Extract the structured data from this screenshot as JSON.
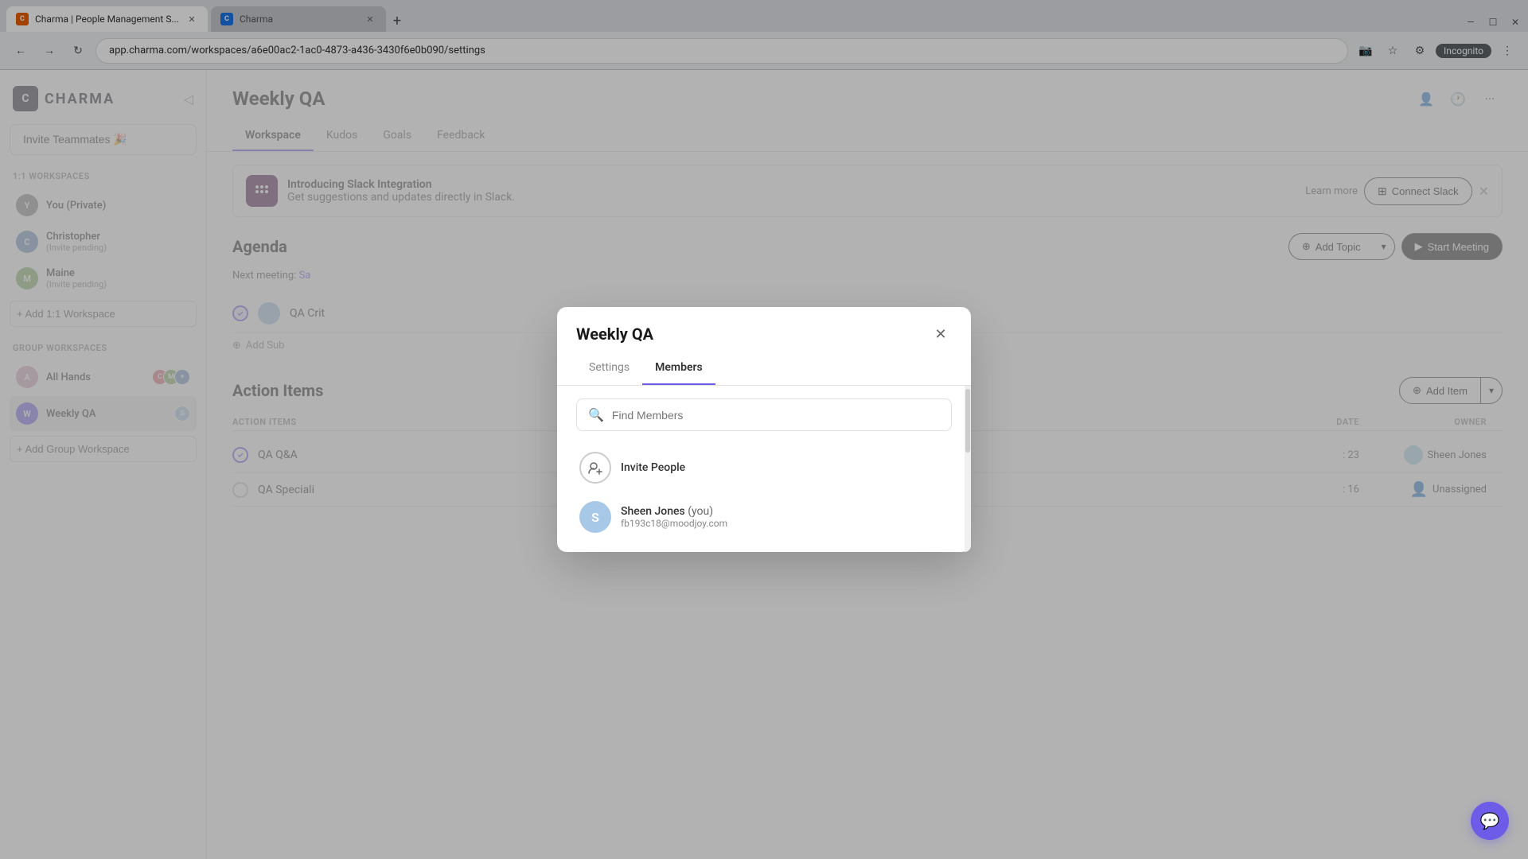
{
  "browser": {
    "tabs": [
      {
        "id": "tab1",
        "label": "Charma | People Management S...",
        "favicon": "C",
        "active": true
      },
      {
        "id": "tab2",
        "label": "Charma",
        "favicon": "C",
        "active": false
      }
    ],
    "address": "app.charma.com/workspaces/a6e00ac2-1ac0-4873-a436-3430f6e0b090/settings",
    "incognito_label": "Incognito"
  },
  "sidebar": {
    "logo_text": "CHARMA",
    "invite_btn": "Invite Teammates 🎉",
    "section_11": "1:1 Workspaces",
    "you_private": "You (Private)",
    "christopher": {
      "name": "Christopher",
      "sub": "(Invite pending)"
    },
    "maine": {
      "name": "Maine",
      "sub": "(Invite pending)"
    },
    "add_11_btn": "+ Add 1:1 Workspace",
    "section_group": "Group Workspaces",
    "all_hands": "All Hands",
    "weekly_qa": "Weekly QA",
    "add_group_btn": "+ Add Group Workspace"
  },
  "main": {
    "page_title": "Weekly QA",
    "tabs": [
      "Workspace",
      "Kudos",
      "Goals",
      "Feedback"
    ],
    "active_tab": "Workspace",
    "slack_banner": {
      "title": "Introducing Slack Integration",
      "description": "Get suggestions and updates directly in Slack.",
      "learn_more": "Learn more",
      "connect_btn": "Connect Slack"
    },
    "agenda": {
      "title": "Agenda",
      "next_meeting": "Next meeting: Sa",
      "add_topic_btn": "Add Topic",
      "start_meeting_btn": "Start Meeting",
      "item": "QA Crit",
      "add_sub": "Add Sub"
    },
    "action_items": {
      "title": "Action Items",
      "add_item_btn": "Add Item",
      "cols": {
        "action": "ACTION ITEMS",
        "date": "DATE",
        "owner": "OWNER"
      },
      "rows": [
        {
          "name": "QA Q&A",
          "date": ": 23",
          "owner": "Sheen Jones",
          "owner_type": "user"
        },
        {
          "name": "QA Speciali",
          "date": ": 16",
          "owner": "Unassigned",
          "owner_type": "unassigned"
        }
      ]
    }
  },
  "modal": {
    "title": "Weekly QA",
    "tabs": [
      "Settings",
      "Members"
    ],
    "active_tab": "Members",
    "search_placeholder": "Find Members",
    "invite_people_label": "Invite People",
    "member": {
      "name": "Sheen Jones",
      "you_tag": "(you)",
      "email": "fb193c18@moodjoy.com"
    }
  },
  "chat": {
    "icon": "💬"
  }
}
